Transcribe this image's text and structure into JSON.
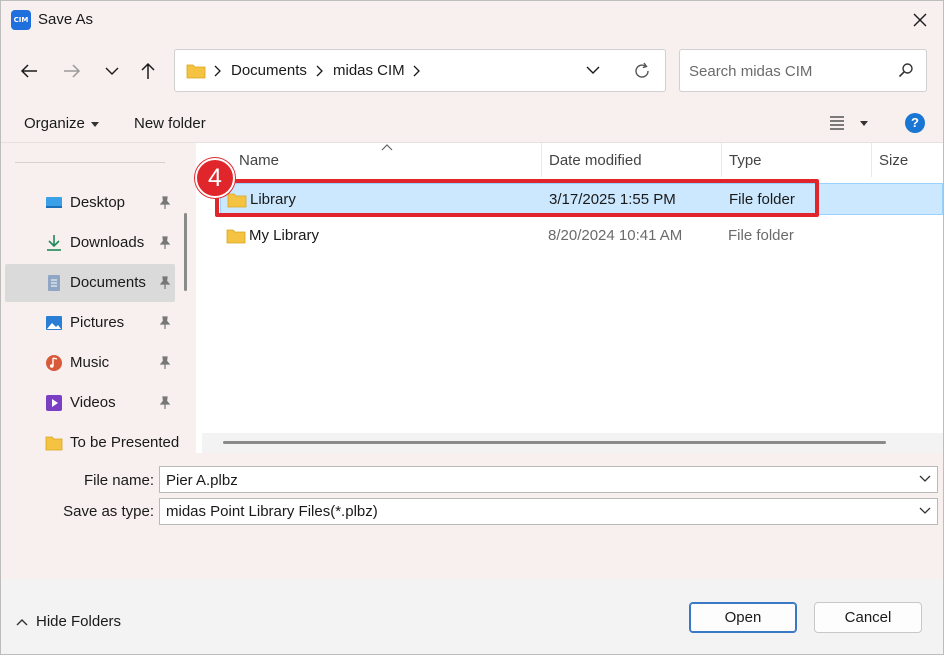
{
  "window": {
    "title": "Save As",
    "app_icon_text": "CIM"
  },
  "address_bar": {
    "breadcrumbs": [
      "Documents",
      "midas CIM"
    ]
  },
  "search": {
    "placeholder": "Search midas CIM"
  },
  "toolbar": {
    "organize_label": "Organize",
    "new_folder_label": "New folder",
    "help_label": "?"
  },
  "sidebar": {
    "items": [
      {
        "label": "Desktop",
        "icon": "desktop-icon",
        "pinned": true
      },
      {
        "label": "Downloads",
        "icon": "downloads-icon",
        "pinned": true
      },
      {
        "label": "Documents",
        "icon": "documents-icon",
        "pinned": true,
        "selected": true
      },
      {
        "label": "Pictures",
        "icon": "pictures-icon",
        "pinned": true
      },
      {
        "label": "Music",
        "icon": "music-icon",
        "pinned": true
      },
      {
        "label": "Videos",
        "icon": "videos-icon",
        "pinned": true
      },
      {
        "label": "To be Presented",
        "icon": "folder-icon",
        "pinned": false
      }
    ]
  },
  "file_list": {
    "columns": [
      "Name",
      "Date modified",
      "Type",
      "Size"
    ],
    "rows": [
      {
        "name": "Library",
        "date": "3/17/2025 1:55 PM",
        "type": "File folder",
        "selected": true
      },
      {
        "name": "My Library",
        "date": "8/20/2024 10:41 AM",
        "type": "File folder",
        "selected": false
      }
    ]
  },
  "annotation": {
    "step_number": "4",
    "color": "#e0262b"
  },
  "fields": {
    "file_name_label": "File name:",
    "file_name_value": "Pier A.plbz",
    "save_type_label": "Save as type:",
    "save_type_value": "midas Point Library Files(*.plbz)"
  },
  "footer": {
    "hide_folders_label": "Hide Folders",
    "open_label": "Open",
    "cancel_label": "Cancel"
  },
  "colors": {
    "accent": "#1976d2",
    "selection": "#cce8ff",
    "folder": "#f5c342"
  }
}
